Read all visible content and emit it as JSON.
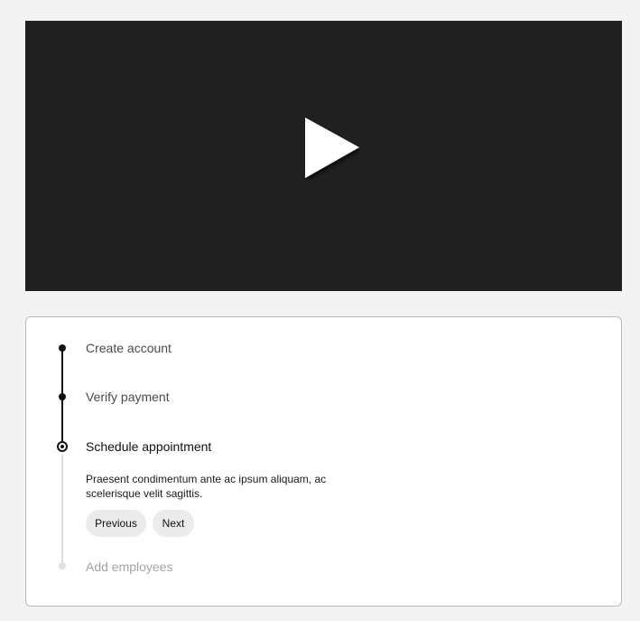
{
  "video": {
    "play_icon": "play-icon"
  },
  "stepper": {
    "steps": [
      {
        "label": "Create account",
        "state": "completed"
      },
      {
        "label": "Verify payment",
        "state": "completed"
      },
      {
        "label": "Schedule appointment",
        "state": "active"
      },
      {
        "label": "Add employees",
        "state": "pending"
      }
    ],
    "active_description": "Praesent condimentum ante ac ipsum aliquam, ac scelerisque velit sagittis.",
    "previous_label": "Previous",
    "next_label": "Next"
  },
  "colors": {
    "page_background": "#f3f3f4",
    "video_background": "#202020",
    "completed": "#111111",
    "pending": "#a4a4a8"
  }
}
